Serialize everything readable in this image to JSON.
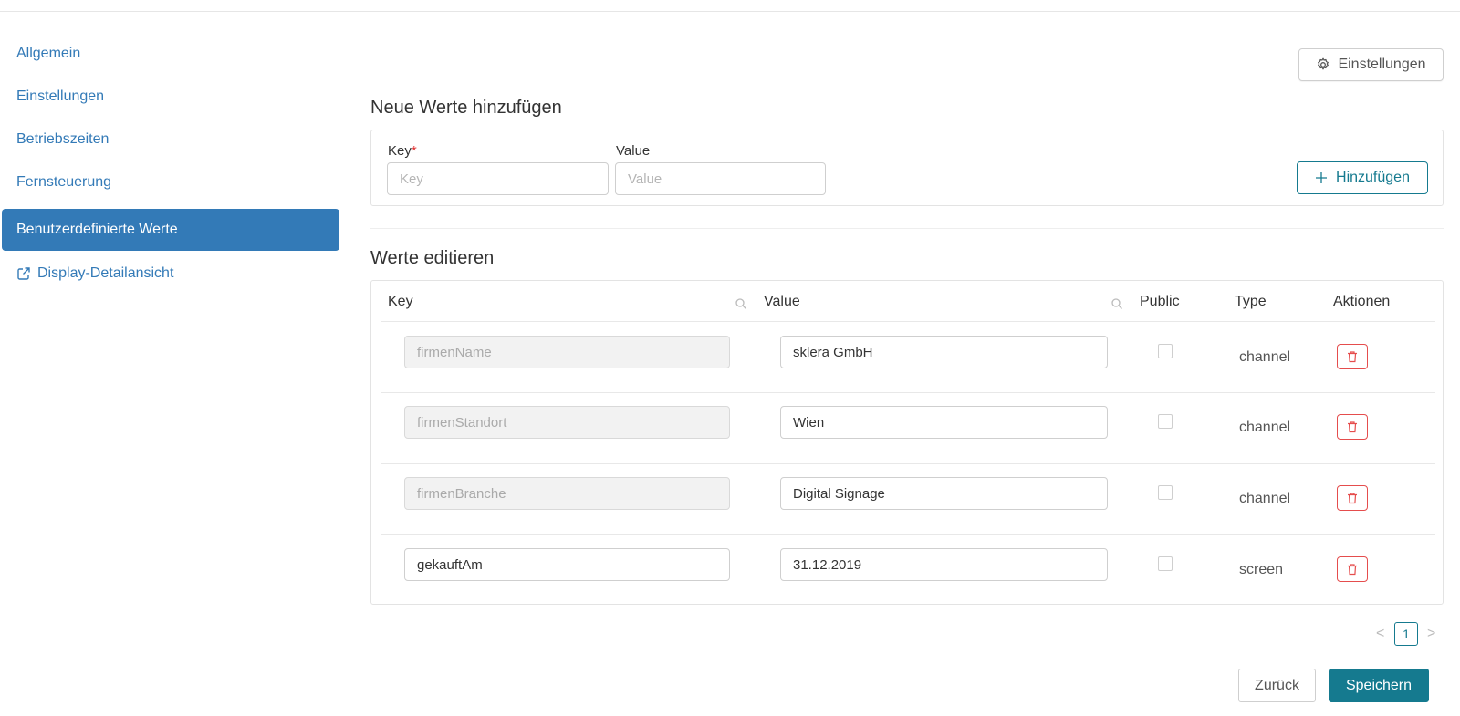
{
  "sidebar": {
    "items": [
      {
        "label": "Allgemein",
        "active": false
      },
      {
        "label": "Einstellungen",
        "active": false
      },
      {
        "label": "Betriebszeiten",
        "active": false
      },
      {
        "label": "Fernsteuerung",
        "active": false
      },
      {
        "label": "Benutzerdefinierte Werte",
        "active": true
      },
      {
        "label": "Display-Detailansicht",
        "active": false,
        "icon": "external-link-icon"
      }
    ]
  },
  "header": {
    "settings_button": {
      "label": "Einstellungen",
      "icon": "gear-icon"
    }
  },
  "new_values": {
    "title": "Neue Werte hinzufügen",
    "key_label": "Key",
    "required_mark": "*",
    "value_label": "Value",
    "key_placeholder": "Key",
    "value_placeholder": "Value",
    "add_button": {
      "label": "Hinzufügen",
      "icon": "plus-icon"
    }
  },
  "edit_values": {
    "title": "Werte editieren",
    "columns": [
      "Key",
      "Value",
      "Public",
      "Type",
      "Aktionen"
    ],
    "rows": [
      {
        "key": "firmenName",
        "value": "sklera GmbH",
        "public": false,
        "type": "channel",
        "key_editable": false
      },
      {
        "key": "firmenStandort",
        "value": "Wien",
        "public": false,
        "type": "channel",
        "key_editable": false
      },
      {
        "key": "firmenBranche",
        "value": "Digital Signage",
        "public": false,
        "type": "channel",
        "key_editable": false
      },
      {
        "key": "gekauftAm",
        "value": "31.12.2019",
        "public": false,
        "type": "screen",
        "key_editable": true
      }
    ]
  },
  "pagination": {
    "current_page": "1",
    "prev": "<",
    "next": ">"
  },
  "footer": {
    "back_label": "Zurück",
    "save_label": "Speichern"
  },
  "colors": {
    "primary": "#337ab7",
    "accent": "#157a8f",
    "danger": "#e54d4d"
  }
}
